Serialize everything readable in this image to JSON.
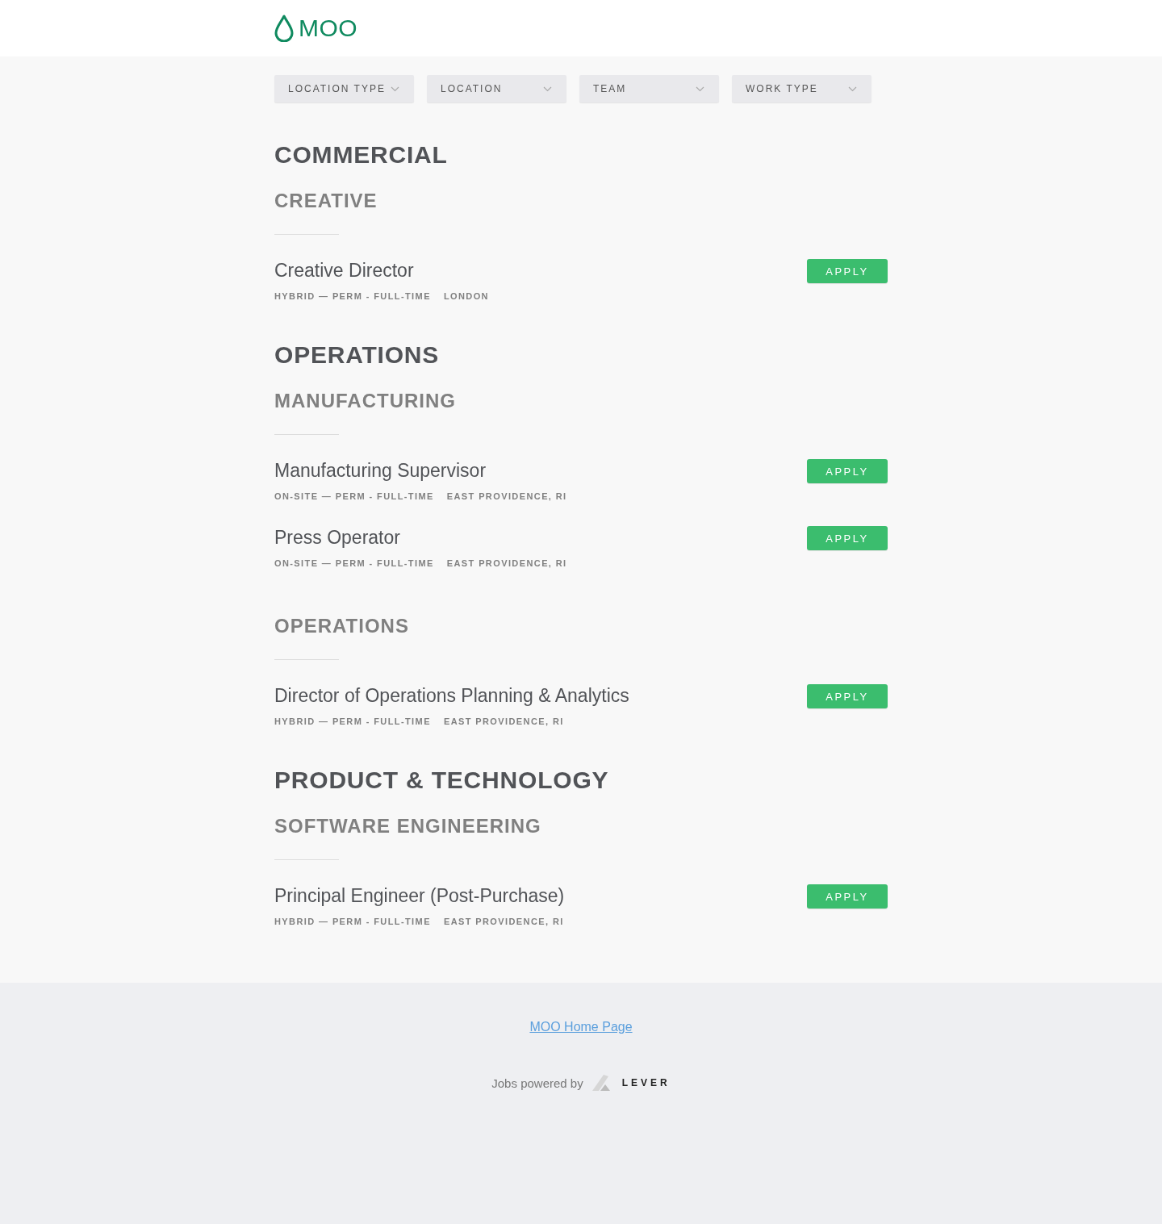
{
  "logo": {
    "text": "MOO"
  },
  "filters": [
    {
      "label": "LOCATION TYPE"
    },
    {
      "label": "LOCATION"
    },
    {
      "label": "TEAM"
    },
    {
      "label": "WORK TYPE"
    }
  ],
  "departments": [
    {
      "name": "COMMERCIAL",
      "teams": [
        {
          "name": "CREATIVE",
          "postings": [
            {
              "title": "Creative Director",
              "commitment": "HYBRID — PERM - FULL-TIME",
              "location": "LONDON",
              "apply": "APPLY"
            }
          ]
        }
      ]
    },
    {
      "name": "OPERATIONS",
      "teams": [
        {
          "name": "MANUFACTURING",
          "postings": [
            {
              "title": "Manufacturing Supervisor",
              "commitment": "ON-SITE — PERM - FULL-TIME",
              "location": "EAST PROVIDENCE, RI",
              "apply": "APPLY"
            },
            {
              "title": "Press Operator",
              "commitment": "ON-SITE — PERM - FULL-TIME",
              "location": "EAST PROVIDENCE, RI",
              "apply": "APPLY"
            }
          ]
        },
        {
          "name": "OPERATIONS",
          "postings": [
            {
              "title": "Director of Operations Planning & Analytics",
              "commitment": "HYBRID — PERM - FULL-TIME",
              "location": "EAST PROVIDENCE, RI",
              "apply": "APPLY"
            }
          ]
        }
      ]
    },
    {
      "name": "PRODUCT & TECHNOLOGY",
      "teams": [
        {
          "name": "SOFTWARE ENGINEERING",
          "postings": [
            {
              "title": "Principal Engineer (Post-Purchase)",
              "commitment": "HYBRID — PERM - FULL-TIME",
              "location": "EAST PROVIDENCE, RI",
              "apply": "APPLY"
            }
          ]
        }
      ]
    }
  ],
  "footer": {
    "home_link": "MOO Home Page",
    "powered_by": "Jobs powered by",
    "lever": "LEVER"
  }
}
